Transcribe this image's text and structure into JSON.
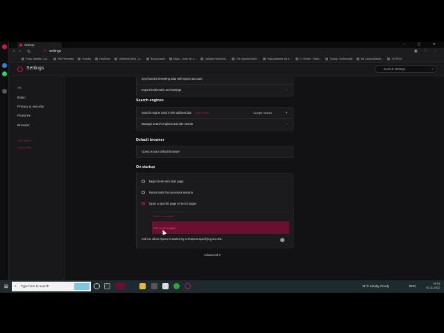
{
  "browser": {
    "tab_title": "Settings",
    "url": "settings",
    "bookmarks": [
      "Posty zabitełe | Clo...",
      "Pan Personeld",
      "Youtube",
      "Facebook",
      "Odstronie (840) - w...",
      "Rozpoznanie",
      "Mapa - Lords of Lo...",
      "Category:Welcome...",
      "The Adoptus Mech...",
      "Wyszukiwanie dla k...",
      "C:\\ Shmer - Resto...",
      "Szukaj: Gmberowski",
      "Bill | www.piratede...",
      "OD'SPLE"
    ]
  },
  "settings": {
    "title": "Settings",
    "search_placeholder": "Search settings",
    "nav": {
      "section": "Alt",
      "items": [
        "Basic",
        "Privacy & security",
        "Features",
        "Browser"
      ],
      "red_links": [
        "Get Opera",
        "Opera Help"
      ]
    },
    "content": {
      "top_rows": [
        "Synchronize browsing data with Opera account",
        "Import bookmarks and settings"
      ],
      "search_engines": {
        "title": "Search engines",
        "engine_label": "Search engine used in the address bar",
        "engine_link": "Learn more",
        "engine_value": "Google Search",
        "manage_label": "Manage search engines and site search"
      },
      "default_browser": {
        "title": "Default browser",
        "text": "Opera is your default browser"
      },
      "on_startup": {
        "title": "On startup",
        "options": [
          "Begin fresh with start page",
          "Retain tabs from previous session",
          "Open a specific page or set of pages"
        ],
        "selected_index": 2,
        "add_page": "Add a new page",
        "use_current": "Use current pages",
        "ask_label": "Ask me when Opera is started by a shortcut specifying an URL"
      },
      "advanced": "Advanced"
    }
  },
  "taskbar": {
    "search_placeholder": "Type here to search",
    "weather": "11°C  Mostly cloudy",
    "lang": "ENG",
    "time": "18:15",
    "date": "30.11.2022"
  },
  "colors": {
    "accent": "#d1145a",
    "highlight": "#6b0f30"
  }
}
